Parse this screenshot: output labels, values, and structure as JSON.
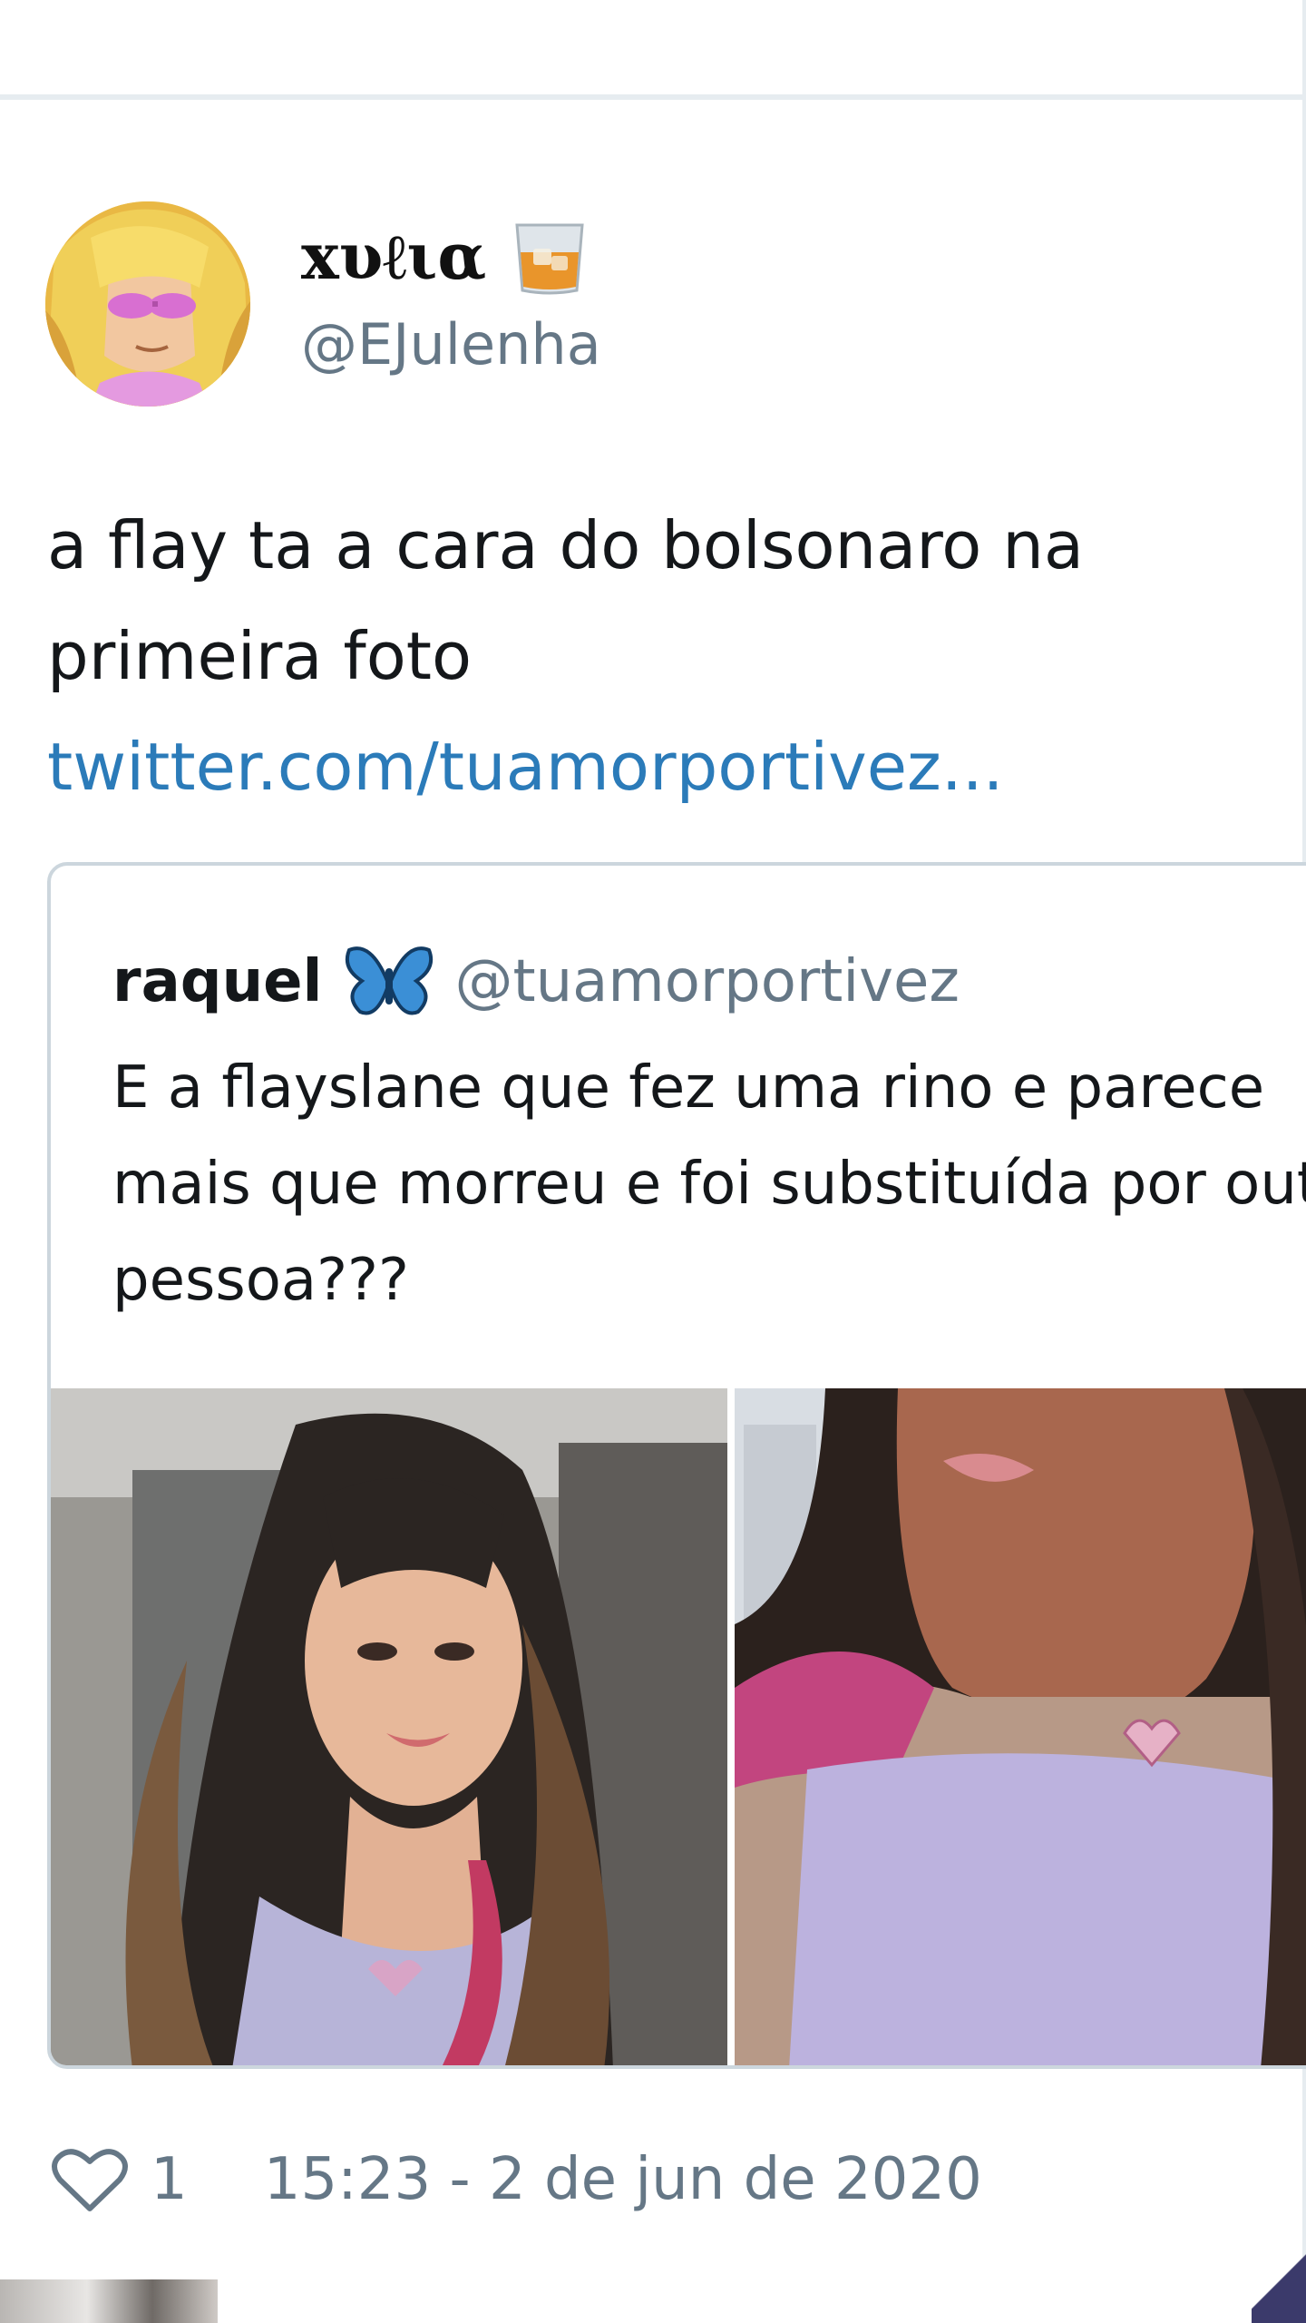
{
  "tweet": {
    "display_name": "xυℓια",
    "name_emoji_icon": "whiskey-glass-icon",
    "handle": "@EJulenha",
    "text": "a flay ta a cara do bolsonaro na primeira foto",
    "link": "twitter.com/tuamorportivez...",
    "likes": "1",
    "timestamp": "15:23 - 2 de jun de 2020"
  },
  "quoted_tweet": {
    "display_name": "raquel",
    "name_emoji_icon": "blue-butterfly-icon",
    "handle": "@tuamorportivez",
    "text": "E a flayslane que fez uma rino e parece mais que morreu e foi substituída por outra pessoa???",
    "media_count": 2
  },
  "colors": {
    "text": "#14171a",
    "secondary": "#657786",
    "link": "#2b7bb9",
    "border": "#ccd6dd",
    "butterfly": "#3b8fd6"
  }
}
